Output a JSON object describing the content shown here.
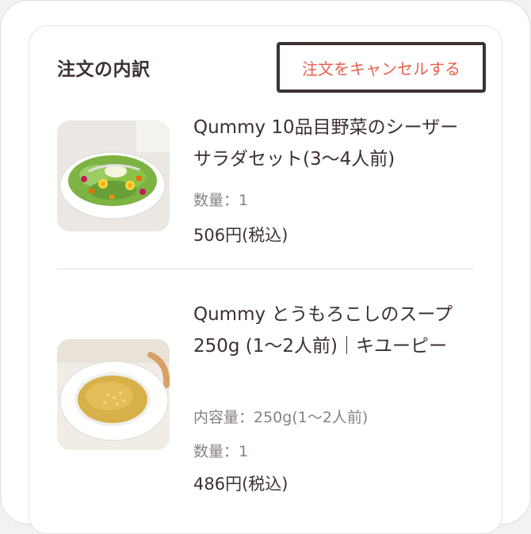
{
  "order": {
    "title": "注文の内訳",
    "cancel_label": "注文をキャンセルする",
    "items": [
      {
        "name": "Qummy 10品目野菜のシーザーサラダセット(3〜4人前)",
        "quantity": "数量：1",
        "price": "506円(税込)",
        "image_icon": "salad-image"
      },
      {
        "name": "Qummy とうもろこしのスープ 250g (1〜2人前)｜キユーピー",
        "volume": "内容量：250g(1〜2人前)",
        "quantity": "数量：1",
        "price": "486円(税込)",
        "image_icon": "soup-image"
      }
    ]
  },
  "colors": {
    "accent": "#e8604c",
    "text": "#3d3030",
    "muted": "#8a8080",
    "button_border": "#3b3232"
  }
}
